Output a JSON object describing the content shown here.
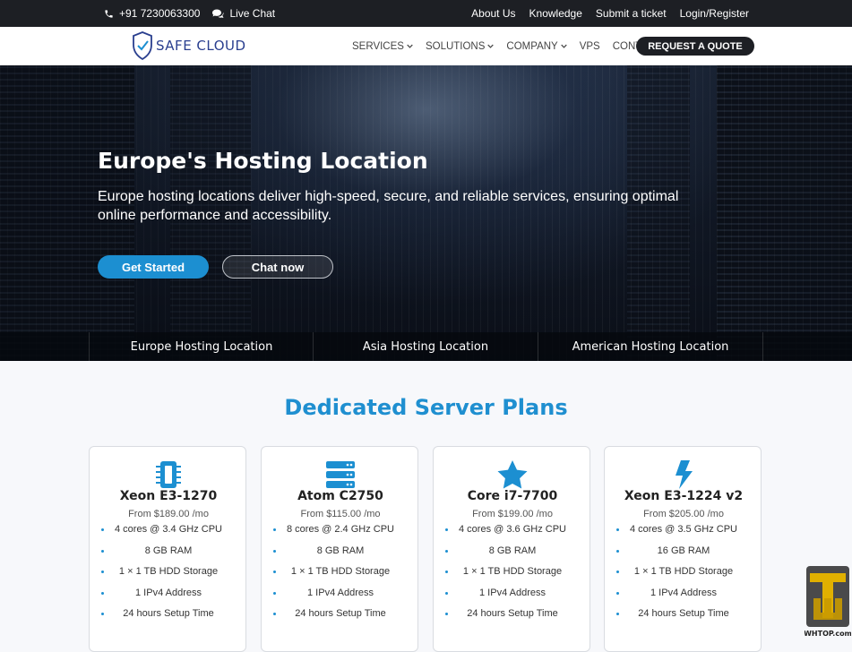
{
  "topbar": {
    "phone": "+91 7230063300",
    "live_chat": "Live Chat",
    "links": [
      "About Us",
      "Knowledge",
      "Submit a ticket",
      "Login/Register"
    ]
  },
  "nav": {
    "logo_text": "SAFE CLOUD",
    "menu": [
      {
        "label": "SERVICES",
        "dropdown": true
      },
      {
        "label": "SOLUTIONS",
        "dropdown": true
      },
      {
        "label": "COMPANY",
        "dropdown": true
      },
      {
        "label": "VPS",
        "dropdown": false
      },
      {
        "label": "CONTACT",
        "dropdown": false
      }
    ],
    "cta": "REQUEST A QUOTE"
  },
  "hero": {
    "title": "Europe's Hosting Location",
    "subtitle": "Europe hosting locations deliver high-speed, secure, and reliable services, ensuring optimal online performance and accessibility.",
    "primary_button": "Get Started",
    "secondary_button": "Chat now",
    "location_tabs": [
      "Europe Hosting Location",
      "Asia Hosting Location",
      "American Hosting Location"
    ]
  },
  "plans": {
    "title": "Dedicated Server Plans",
    "cards": [
      {
        "icon": "chip-icon",
        "name": "Xeon E3-1270",
        "price": "From $189.00 /mo",
        "features": [
          "4 cores @ 3.4 GHz CPU",
          "8 GB RAM",
          "1 × 1 TB HDD Storage",
          "1 IPv4 Address",
          "24 hours Setup Time"
        ]
      },
      {
        "icon": "server-icon",
        "name": "Atom C2750",
        "price": "From $115.00 /mo",
        "features": [
          "8 cores @ 2.4 GHz CPU",
          "8 GB RAM",
          "1 × 1 TB HDD Storage",
          "1 IPv4 Address",
          "24 hours Setup Time"
        ]
      },
      {
        "icon": "star-icon",
        "name": "Core i7-7700",
        "price": "From $199.00 /mo",
        "features": [
          "4 cores @ 3.6 GHz CPU",
          "8 GB RAM",
          "1 × 1 TB HDD Storage",
          "1 IPv4 Address",
          "24 hours Setup Time"
        ]
      },
      {
        "icon": "bolt-icon",
        "name": "Xeon E3-1224 v2",
        "price": "From $205.00 /mo",
        "features": [
          "4 cores @ 3.5 GHz CPU",
          "16 GB RAM",
          "1 × 1 TB HDD Storage",
          "1 IPv4 Address",
          "24 hours Setup Time"
        ]
      }
    ]
  },
  "watermark_text": "WHTOP.com",
  "colors": {
    "accent": "#1c8fd1",
    "dark": "#1d1f24",
    "logo": "#2a3f8f",
    "watermark": "#e0b000"
  }
}
